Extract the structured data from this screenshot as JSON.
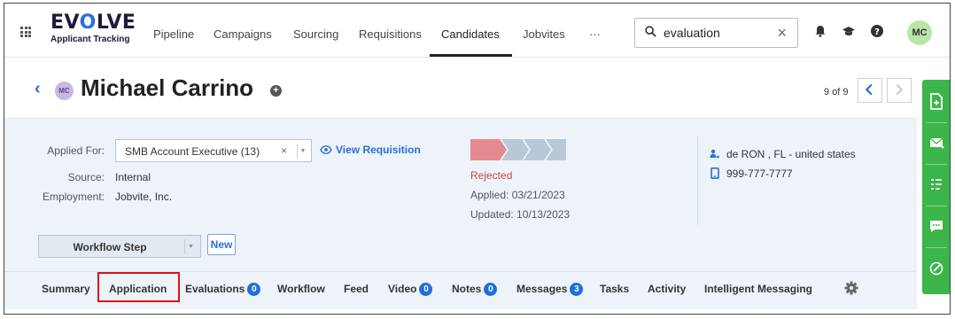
{
  "app": {
    "logo_text_1": "EV",
    "logo_text_o": "O",
    "logo_text_2": "LVE",
    "logo_sub": "Applicant Tracking"
  },
  "nav": {
    "items": [
      "Pipeline",
      "Campaigns",
      "Sourcing",
      "Requisitions",
      "Candidates",
      "Jobvites",
      "···"
    ],
    "active": "Candidates"
  },
  "search": {
    "value": "evaluation",
    "placeholder": "Search"
  },
  "user": {
    "initials": "MC"
  },
  "candidate": {
    "initials": "MC",
    "name": "Michael Carrino",
    "pager_text": "9 of 9"
  },
  "details": {
    "applied_for_label": "Applied For:",
    "applied_for_value": "SMB Account Executive (13)",
    "view_requisition": "View Requisition",
    "source_label": "Source:",
    "source_value": "Internal",
    "employment_label": "Employment:",
    "employment_value": "Jobvite, Inc.",
    "status": "Rejected",
    "applied_text": "Applied:  03/21/2023",
    "updated_text": "Updated:  10/13/2023",
    "location": "de RON , FL - united states",
    "phone": "999-777-7777"
  },
  "workflow": {
    "select_label": "Workflow Step",
    "new_label": "New"
  },
  "tabs": [
    {
      "label": "Summary"
    },
    {
      "label": "Application",
      "highlighted": true
    },
    {
      "label": "Evaluations",
      "badge": "0"
    },
    {
      "label": "Workflow"
    },
    {
      "label": "Feed"
    },
    {
      "label": "Video",
      "badge": "0"
    },
    {
      "label": "Notes",
      "badge": "0"
    },
    {
      "label": "Messages",
      "badge": "3"
    },
    {
      "label": "Tasks"
    },
    {
      "label": "Activity"
    },
    {
      "label": "Intelligent Messaging"
    }
  ],
  "colors": {
    "accent_blue": "#2b6fd6",
    "side_green": "#3cb54a",
    "rejected_red": "#c24a4a",
    "highlight_red": "#e0101a"
  }
}
